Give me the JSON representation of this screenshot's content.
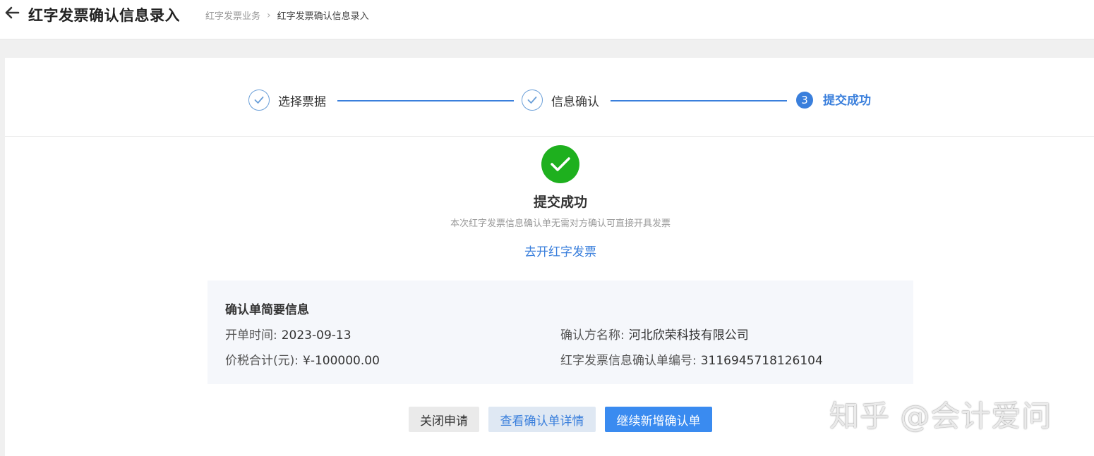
{
  "header": {
    "title": "红字发票确认信息录入",
    "breadcrumb": [
      "红字发票业务",
      "红字发票确认信息录入"
    ]
  },
  "steps": [
    {
      "label": "选择票据",
      "state": "done"
    },
    {
      "label": "信息确认",
      "state": "done"
    },
    {
      "number": "3",
      "label": "提交成功",
      "state": "active"
    }
  ],
  "result": {
    "title": "提交成功",
    "description": "本次红字发票信息确认单无需对方确认可直接开具发票",
    "link_label": "去开红字发票"
  },
  "summary": {
    "heading": "确认单简要信息",
    "open_date_label": "开单时间:",
    "open_date": "2023-09-13",
    "total_label": "价税合计(元):",
    "total": "¥-100000.00",
    "confirmer_label": "确认方名称:",
    "confirmer": "河北欣荣科技有限公司",
    "number_label": "红字发票信息确认单编号:",
    "number": "3116945718126104"
  },
  "actions": {
    "close_label": "关闭申请",
    "view_label": "查看确认单详情",
    "add_label": "继续新增确认单"
  },
  "watermark": "知乎 @会计爱问",
  "colors": {
    "accent": "#3a7fdc",
    "success": "#1eb01e",
    "primary_button": "#3a8bf0"
  }
}
